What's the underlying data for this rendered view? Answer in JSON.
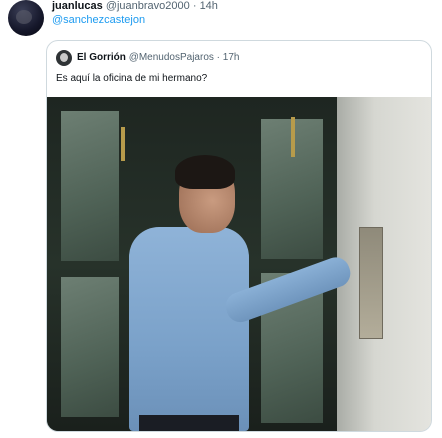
{
  "tweet": {
    "display_name": "juanlucas",
    "handle": "@juanbravo2000",
    "separator": "·",
    "time": "14h",
    "reply_to": "@sanchezcastejon"
  },
  "quoted_tweet": {
    "display_name": "El Gorrión",
    "handle": "@MenudosPajaros",
    "separator": "·",
    "time": "17h",
    "text": "Es aquí la oficina de mi hermano?"
  },
  "icons": {
    "avatar": "user-avatar",
    "quoted_avatar": "user-avatar"
  }
}
